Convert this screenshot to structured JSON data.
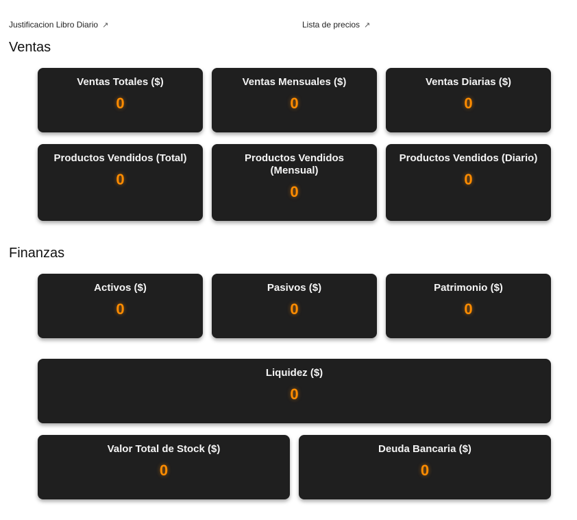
{
  "links": {
    "journal": {
      "label": "Justificacion Libro Diario",
      "icon": "external-link-icon"
    },
    "prices": {
      "label": "Lista de precios",
      "icon": "external-link-icon"
    }
  },
  "sections": {
    "sales": "Ventas",
    "finance": "Finanzas"
  },
  "cards": {
    "ventas_totales": {
      "title": "Ventas Totales ($)",
      "value": "0"
    },
    "ventas_mensuales": {
      "title": "Ventas Mensuales ($)",
      "value": "0"
    },
    "ventas_diarias": {
      "title": "Ventas Diarias ($)",
      "value": "0"
    },
    "productos_total": {
      "title": "Productos Vendidos (Total)",
      "value": "0"
    },
    "productos_mensual": {
      "title": "Productos Vendidos (Mensual)",
      "value": "0"
    },
    "productos_diario": {
      "title": "Productos Vendidos (Diario)",
      "value": "0"
    },
    "activos": {
      "title": "Activos ($)",
      "value": "0"
    },
    "pasivos": {
      "title": "Pasivos ($)",
      "value": "0"
    },
    "patrimonio": {
      "title": "Patrimonio ($)",
      "value": "0"
    },
    "liquidez": {
      "title": "Liquidez ($)",
      "value": "0"
    },
    "stock": {
      "title": "Valor Total de Stock ($)",
      "value": "0"
    },
    "deuda": {
      "title": "Deuda Bancaria ($)",
      "value": "0"
    }
  },
  "colors": {
    "card_bg": "#1f1f1f",
    "value_accent": "#ff8c00"
  }
}
